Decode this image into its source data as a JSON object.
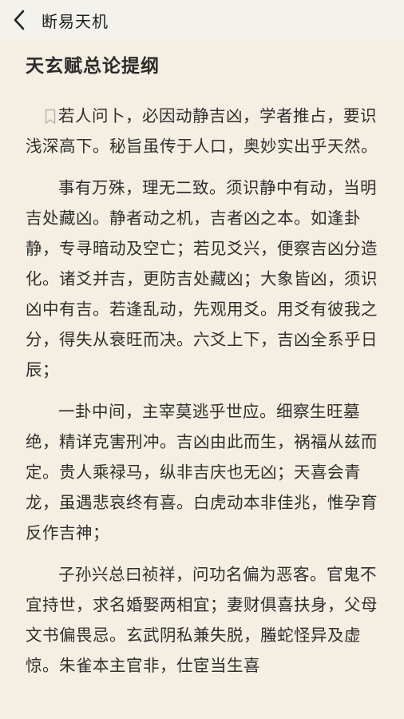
{
  "header": {
    "title": "断易天机"
  },
  "chapter": {
    "title": "天玄赋总论提纲"
  },
  "paragraphs": [
    "若人问卜，必因动静吉凶，学者推占，要识浅深高下。秘旨虽传于人口，奥妙实出乎天然。",
    "事有万殊，理无二致。须识静中有动，当明吉处藏凶。静者动之机，吉者凶之本。如逢卦静，专寻暗动及空亡；若见爻兴，便察吉凶分造化。诸爻并吉，更防吉处藏凶；大象皆凶，须识凶中有吉。若逢乱动，先观用爻。用爻有彼我之分，得失从衰旺而决。六爻上下，吉凶全系乎日辰；",
    "一卦中间，主宰莫逃乎世应。细察生旺墓绝，精详克害刑冲。吉凶由此而生，祸福从兹而定。贵人乘禄马，纵非吉庆也无凶；天喜会青龙，虽遇悲哀终有喜。白虎动本非佳兆，惟孕育反作吉神；",
    "子孙兴总曰祯祥，问功名偏为恶客。官鬼不宜持世，求名婚娶两相宜；妻财俱喜扶身，父母文书偏畏忌。玄武阴私兼失脱，螣蛇怪异及虚惊。朱雀本主官非，仕宦当生喜"
  ],
  "icons": {
    "back": "chevron-left-icon",
    "bookmark": "bookmark-icon"
  },
  "colors": {
    "page_background": "#f4efe2",
    "header_background": "#f4f2ec",
    "text": "#2f2f2f"
  }
}
